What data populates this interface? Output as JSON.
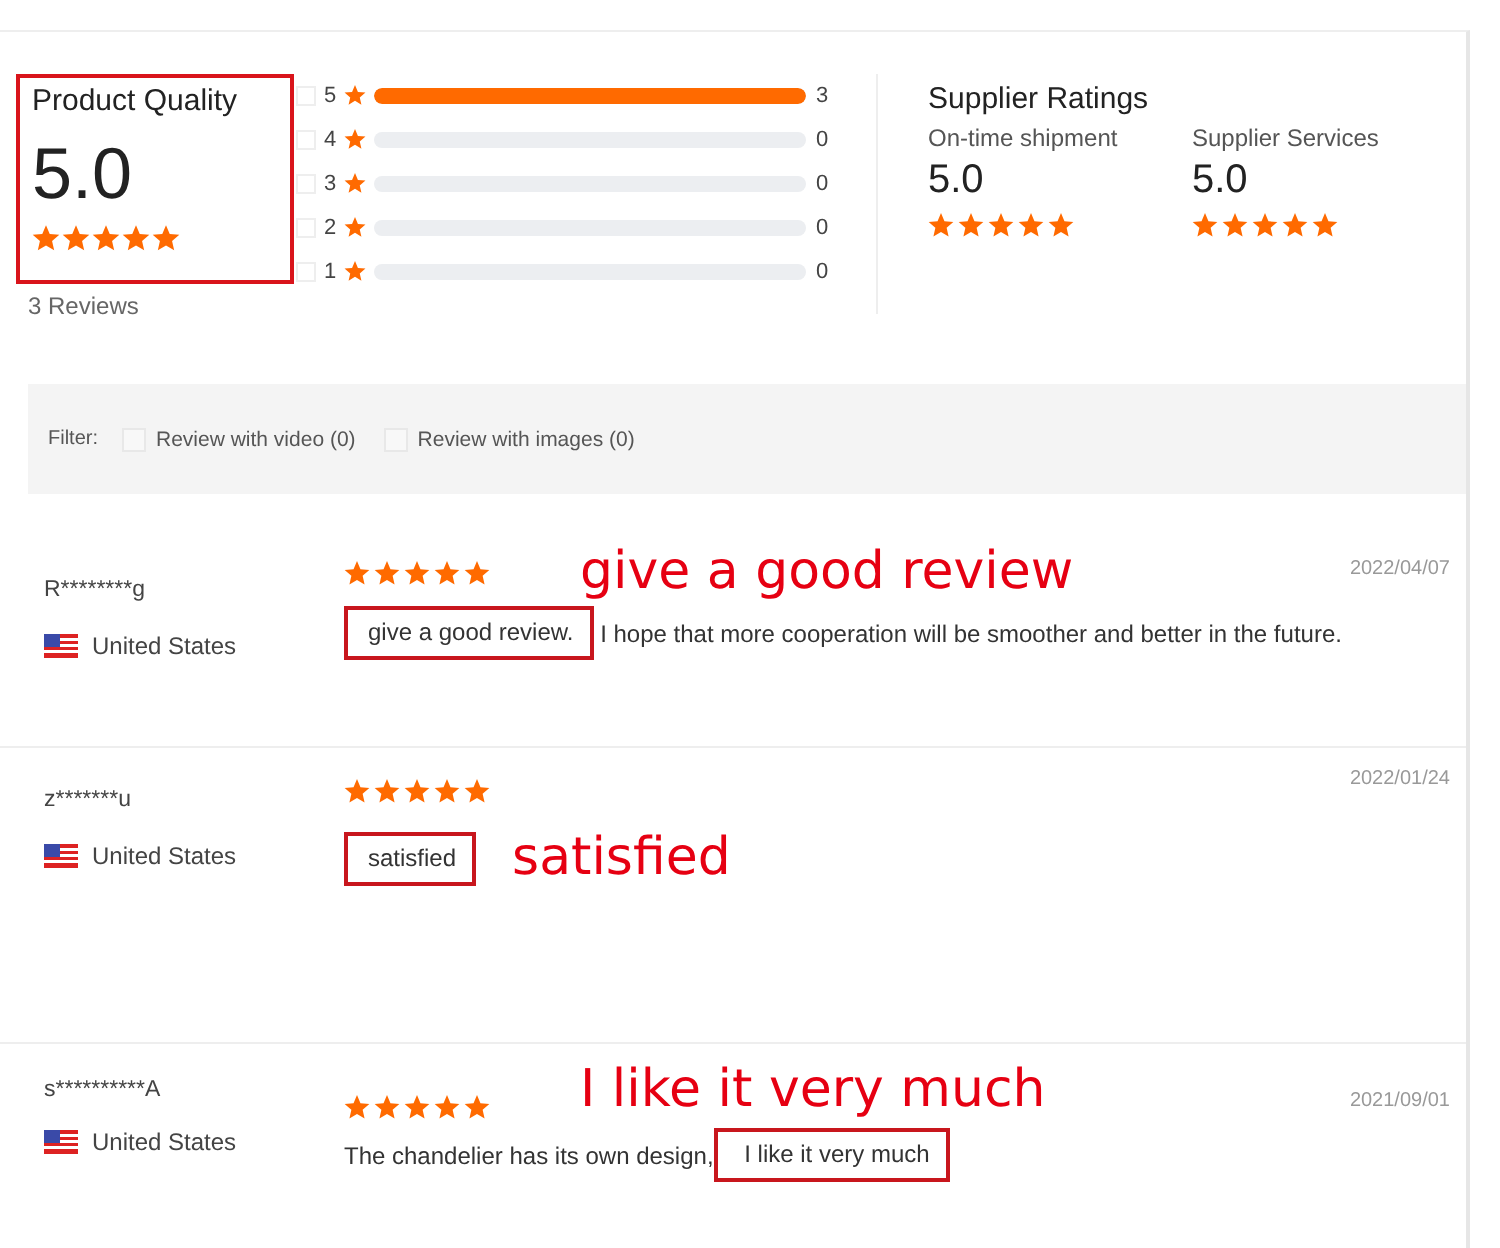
{
  "product_quality": {
    "title": "Product Quality",
    "score": "5.0",
    "stars": 5,
    "reviews_count": "3 Reviews"
  },
  "rating_bars": [
    {
      "label": "5",
      "level": 1.0,
      "count": "3",
      "checked": false
    },
    {
      "label": "4",
      "level": 0,
      "count": "0",
      "checked": false
    },
    {
      "label": "3",
      "level": 0,
      "count": "0",
      "checked": false
    },
    {
      "label": "2",
      "level": 0,
      "count": "0",
      "checked": false
    },
    {
      "label": "1",
      "level": 0,
      "count": "0",
      "checked": false
    }
  ],
  "supplier_ratings": {
    "title": "Supplier Ratings",
    "items": [
      {
        "label": "On-time shipment",
        "score": "5.0",
        "stars": 5
      },
      {
        "label": "Supplier Services",
        "score": "5.0",
        "stars": 5
      }
    ]
  },
  "filter": {
    "label": "Filter:",
    "options": [
      {
        "label": "Review with video (0)",
        "checked": false
      },
      {
        "label": "Review with images (0)",
        "checked": false
      }
    ]
  },
  "reviews": [
    {
      "user": "R********g",
      "country": "United States",
      "stars": 5,
      "date": "2022/04/07",
      "stars_note": "give a good review",
      "comment": [
        {
          "text": "give a good review.",
          "highlighted": true
        },
        {
          "text": " I hope that more cooperation will be smoother and better in the future.",
          "highlighted": false
        }
      ]
    },
    {
      "user": "z*******u",
      "country": "United States",
      "stars": 5,
      "date": "2022/01/24",
      "comment_note": "satisfied",
      "comment": [
        {
          "text": "satisfied",
          "highlighted": true
        }
      ]
    },
    {
      "user": "s**********A",
      "country": "United States",
      "stars": 5,
      "date": "2021/09/01",
      "stars_note": "I like it very much",
      "comment": [
        {
          "text": "The chandelier has its own design,",
          "highlighted": false
        },
        {
          "text": " I like it very much",
          "highlighted": true
        }
      ]
    }
  ]
}
